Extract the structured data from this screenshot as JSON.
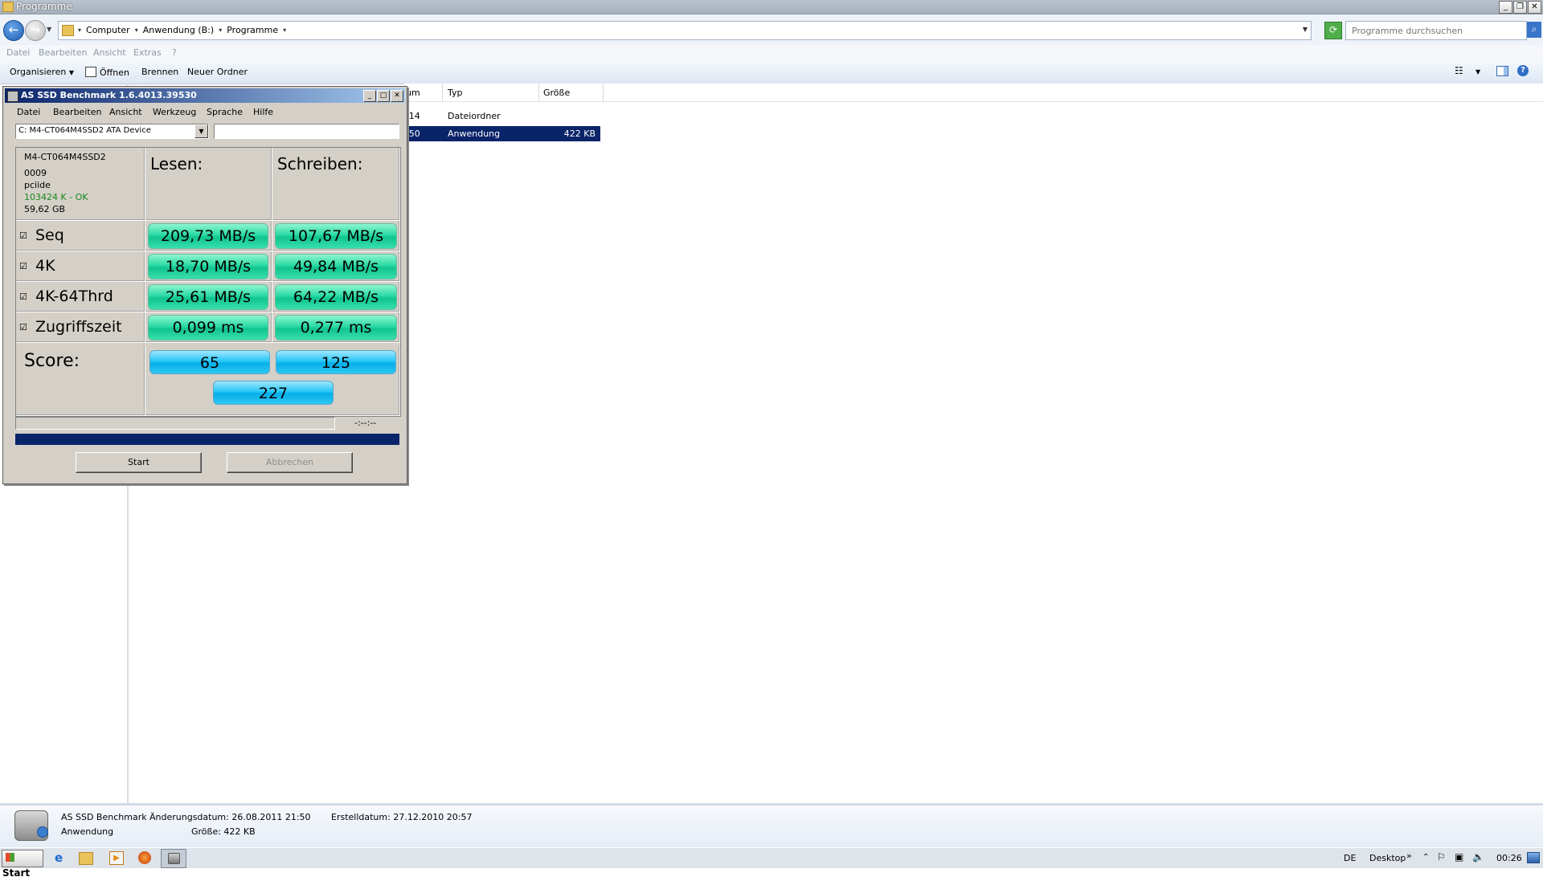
{
  "explorer": {
    "title": "Programme",
    "breadcrumbs": [
      "Computer",
      "Anwendung (B:)",
      "Programme"
    ],
    "search_placeholder": "Programme durchsuchen",
    "menu": [
      "Datei",
      "Bearbeiten",
      "Ansicht",
      "Extras",
      "?"
    ],
    "toolbar": {
      "organize": "Organisieren",
      "open": "Öffnen",
      "burn": "Brennen",
      "new_folder": "Neuer Ordner"
    },
    "columns": {
      "date_fragment": "um",
      "type": "Typ",
      "size": "Größe"
    },
    "files": [
      {
        "date_fragment": ":14",
        "type": "Dateiordner",
        "size": ""
      },
      {
        "date_fragment": ":50",
        "type": "Anwendung",
        "size": "422 KB"
      }
    ],
    "details": {
      "name": "AS SSD Benchmark",
      "type": "Anwendung",
      "modified_label": "Änderungsdatum: 26.08.2011 21:50",
      "size_label": "Größe: 422 KB",
      "created_label": "Erstelldatum: 27.12.2010 20:57"
    }
  },
  "taskbar": {
    "start": "Start",
    "language": "DE",
    "desktop": "Desktop",
    "chevron": "»",
    "time": "00:26"
  },
  "benchmark": {
    "title": "AS SSD Benchmark 1.6.4013.39530",
    "menu": [
      "Datei",
      "Bearbeiten",
      "Ansicht",
      "Werkzeug",
      "Sprache",
      "Hilfe"
    ],
    "device": "C: M4-CT064M4SSD2 ATA Device",
    "info": {
      "model": "M4-CT064M4SSD2",
      "firmware": "0009",
      "driver": "pciide",
      "alignment": "103424 K - OK",
      "capacity": "59,62 GB"
    },
    "headers": {
      "read": "Lesen:",
      "write": "Schreiben:"
    },
    "rows": [
      {
        "label": "Seq",
        "read": "209,73 MB/s",
        "write": "107,67 MB/s"
      },
      {
        "label": "4K",
        "read": "18,70 MB/s",
        "write": "49,84 MB/s"
      },
      {
        "label": "4K-64Thrd",
        "read": "25,61 MB/s",
        "write": "64,22 MB/s"
      },
      {
        "label": "Zugriffszeit",
        "read": "0,099 ms",
        "write": "0,277 ms"
      }
    ],
    "score": {
      "label": "Score:",
      "read": "65",
      "write": "125",
      "total": "227"
    },
    "elapsed": "-:--:--",
    "buttons": {
      "start": "Start",
      "abort": "Abbrechen"
    },
    "colors": {
      "result_green": "#2ad9a4",
      "score_blue": "#27c6f6",
      "progress_navy": "#0a246a",
      "alignment_ok": "#1a8a1a"
    }
  }
}
